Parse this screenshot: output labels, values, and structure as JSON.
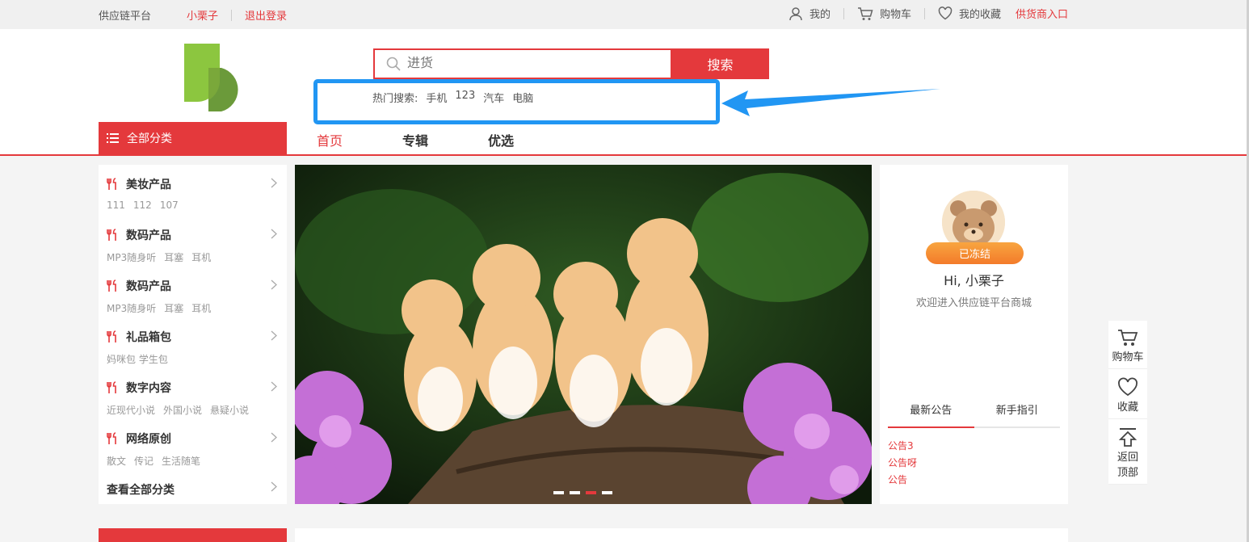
{
  "topbar": {
    "platform": "供应链平台",
    "username": "小栗子",
    "logout": "退出登录",
    "my": "我的",
    "cart": "购物车",
    "favorites": "我的收藏",
    "supplier_entry": "供货商入口"
  },
  "search": {
    "placeholder": "进货",
    "button": "搜索",
    "hot_label": "热门搜索:",
    "hot_terms": [
      "手机",
      "123",
      "汽车",
      "电脑"
    ]
  },
  "categories_button": "全部分类",
  "nav": [
    "首页",
    "专辑",
    "优选"
  ],
  "categories": [
    {
      "title": "美妆产品",
      "subs": [
        "111",
        "112",
        "107"
      ]
    },
    {
      "title": "数码产品",
      "subs": [
        "MP3随身听",
        "耳塞",
        "耳机"
      ]
    },
    {
      "title": "数码产品",
      "subs": [
        "MP3随身听",
        "耳塞",
        "耳机"
      ]
    },
    {
      "title": "礼品箱包",
      "subs": [
        "妈咪包 学生包"
      ]
    },
    {
      "title": "数字内容",
      "subs": [
        "近现代小说",
        "外国小说",
        "悬疑小说"
      ]
    },
    {
      "title": "网络原创",
      "subs": [
        "散文",
        "传记",
        "生活随笔"
      ]
    }
  ],
  "all_categories": "查看全部分类",
  "banner": {
    "slides": 4,
    "active_slide": 3
  },
  "user": {
    "status": "已冻结",
    "greeting": "Hi, 小栗子",
    "welcome": "欢迎进入供应链平台商城"
  },
  "tabs": [
    "最新公告",
    "新手指引"
  ],
  "notices": [
    "公告3",
    "公告呀",
    "公告"
  ],
  "float_bar": {
    "cart": "购物车",
    "favorite": "收藏",
    "back_top_line1": "返回",
    "back_top_line2": "顶部"
  },
  "colors": {
    "accent": "#e4393c",
    "highlight": "#2196f3",
    "badge": "#f68a34"
  }
}
